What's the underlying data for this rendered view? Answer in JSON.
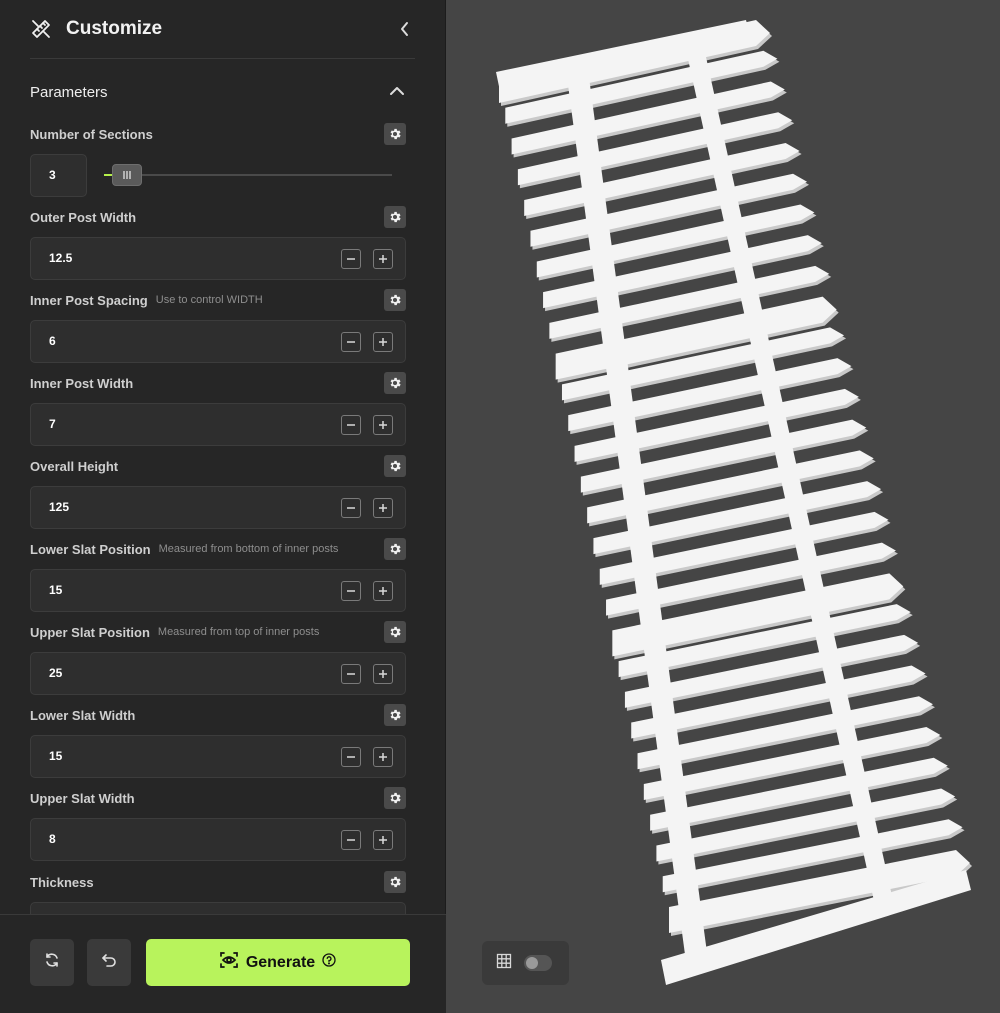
{
  "header": {
    "title": "Customize"
  },
  "section": {
    "label": "Parameters"
  },
  "params": [
    {
      "name": "Number of Sections",
      "hint": "",
      "value": "3",
      "kind": "slider",
      "slider_fraction": 0.03
    },
    {
      "name": "Outer Post Width",
      "hint": "",
      "value": "12.5",
      "kind": "stepper"
    },
    {
      "name": "Inner Post Spacing",
      "hint": "Use to control WIDTH",
      "value": "6",
      "kind": "stepper"
    },
    {
      "name": "Inner Post Width",
      "hint": "",
      "value": "7",
      "kind": "stepper"
    },
    {
      "name": "Overall Height",
      "hint": "",
      "value": "125",
      "kind": "stepper"
    },
    {
      "name": "Lower Slat Position",
      "hint": "Measured from bottom of inner posts",
      "value": "15",
      "kind": "stepper"
    },
    {
      "name": "Upper Slat Position",
      "hint": "Measured from top of inner posts",
      "value": "25",
      "kind": "stepper"
    },
    {
      "name": "Lower Slat Width",
      "hint": "",
      "value": "15",
      "kind": "stepper"
    },
    {
      "name": "Upper Slat Width",
      "hint": "",
      "value": "8",
      "kind": "stepper"
    },
    {
      "name": "Thickness",
      "hint": "",
      "value": "",
      "kind": "stepper"
    }
  ],
  "footer": {
    "generate_label": "Generate"
  },
  "colors": {
    "accent": "#b8f35c",
    "sidebar": "#262626",
    "viewport": "#454545",
    "model": "#f4f4f4"
  },
  "icons": {
    "logo": "ruler-pencil-icon",
    "collapse": "chevron-left-icon",
    "section_toggle": "chevron-up-icon",
    "param_settings": "gear-icon",
    "reset": "refresh-icon",
    "undo": "undo-icon",
    "generate": "eye-scan-icon",
    "help": "help-circle-icon",
    "grid": "grid-icon"
  }
}
